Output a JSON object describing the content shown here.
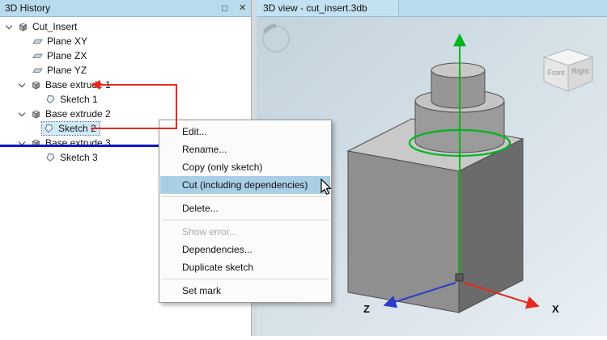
{
  "left_panel": {
    "title": "3D History",
    "window_buttons": {
      "maximize": "□",
      "close": "×"
    },
    "tree": [
      {
        "label": "Cut_Insert"
      },
      {
        "label": "Plane XY"
      },
      {
        "label": "Plane ZX"
      },
      {
        "label": "Plane YZ"
      },
      {
        "label": "Base extrude 1"
      },
      {
        "label": "Sketch 1"
      },
      {
        "label": "Base extrude 2"
      },
      {
        "label": "Sketch 2"
      },
      {
        "label": "Base extrude 3"
      },
      {
        "label": "Sketch 3"
      }
    ]
  },
  "right_panel": {
    "title": "3D view - cut_insert.3db",
    "view_cube": {
      "front": "Front",
      "right": "Right"
    },
    "axes": {
      "x": "X",
      "z": "Z"
    }
  },
  "context_menu": {
    "items": [
      "Edit...",
      "Rename...",
      "Copy (only sketch)",
      "Cut (including dependencies)",
      "Delete...",
      "Show error...",
      "Dependencies...",
      "Duplicate sketch",
      "Set mark"
    ]
  },
  "colors": {
    "titlebar": "#b9dcec",
    "selection": "#d0eafa",
    "menu_highlight": "#a9cfe6",
    "annotation_red": "#e8281e",
    "mark_blue": "#1216c4",
    "axis_green": "#00b51e",
    "axis_red": "#e8281e",
    "axis_blue": "#2b3cc8"
  }
}
